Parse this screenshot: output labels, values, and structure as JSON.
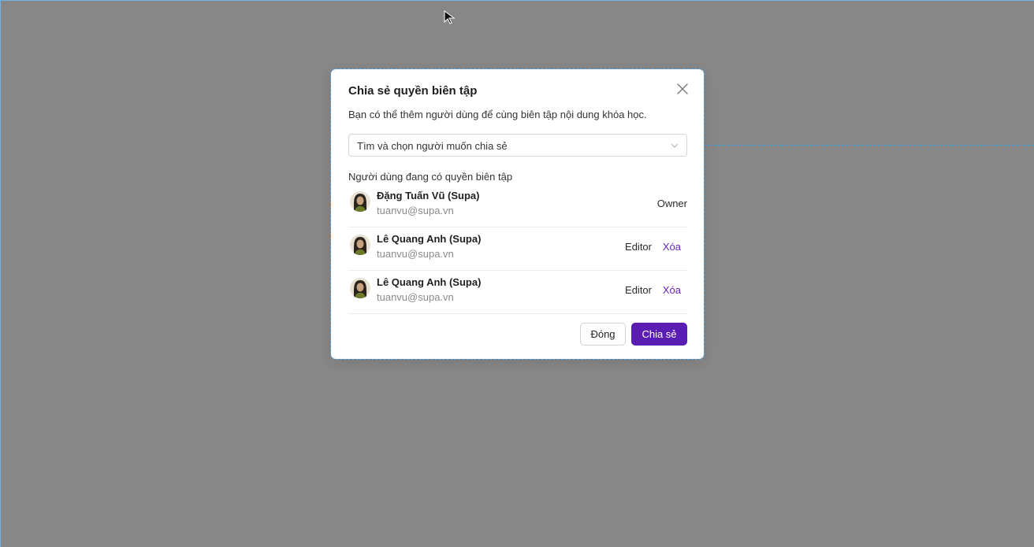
{
  "dialog": {
    "title": "Chia sẻ quyền biên tập",
    "description": "Bạn có thể thêm người dùng để cùng biên tập nội dung khóa học.",
    "search": {
      "placeholder": "Tìm và chọn người muốn chia sẻ"
    },
    "section_label": "Người dùng đang có quyền biên tập",
    "users": [
      {
        "name": "Đặng Tuấn Vũ (Supa)",
        "email": "tuanvu@supa.vn",
        "role": "Owner",
        "remove_label": ""
      },
      {
        "name": "Lê Quang Anh (Supa)",
        "email": "tuanvu@supa.vn",
        "role": "Editor",
        "remove_label": "Xóa"
      },
      {
        "name": "Lê Quang Anh (Supa)",
        "email": "tuanvu@supa.vn",
        "role": "Editor",
        "remove_label": "Xóa"
      }
    ],
    "buttons": {
      "close_label": "Đóng",
      "share_label": "Chia sẻ"
    }
  },
  "icons": {
    "close": "close-icon",
    "chevron": "chevron-down-icon",
    "cursor": "cursor-pointer-icon",
    "avatar": "user-avatar"
  },
  "colors": {
    "backdrop": "#878787",
    "primary": "#5a1db3",
    "link": "#6b21c8",
    "connector": "#2f9be0"
  }
}
